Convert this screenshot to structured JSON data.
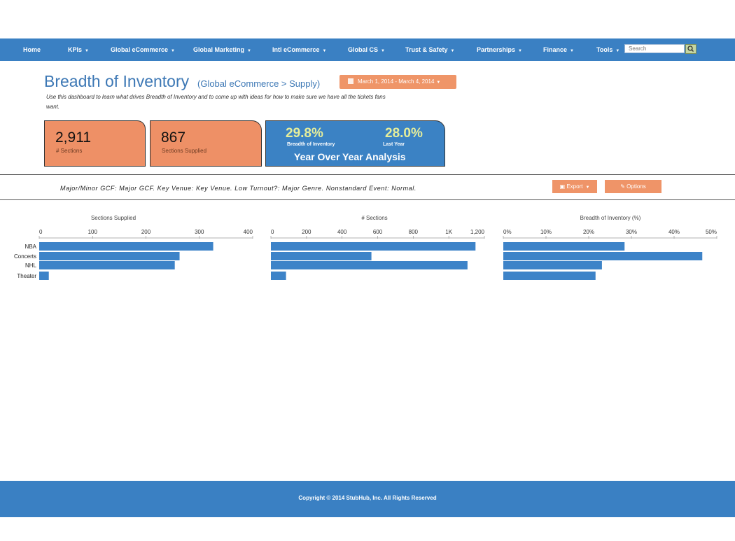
{
  "nav": {
    "items": [
      {
        "label": "Home",
        "caret": false
      },
      {
        "label": "KPIs",
        "caret": true
      },
      {
        "label": "Global eCommerce",
        "caret": true
      },
      {
        "label": "Global Marketing",
        "caret": true
      },
      {
        "label": "Intl eCommerce",
        "caret": true
      },
      {
        "label": "Global CS",
        "caret": true
      },
      {
        "label": "Trust & Safety",
        "caret": true
      },
      {
        "label": "Partnerships",
        "caret": true
      },
      {
        "label": "Finance",
        "caret": true
      },
      {
        "label": "Tools",
        "caret": true
      }
    ],
    "search_placeholder": "Search",
    "search_icon": "search-icon"
  },
  "header": {
    "title": "Breadth of Inventory",
    "breadcrumb": "(Global eCommerce > Supply)",
    "date_range": "March 1, 2014 - March 4, 2014",
    "description": "Use this dashboard to learn what drives Breadth of Inventory and to come up with ideas for how to make sure we have all the tickets fans want."
  },
  "kpis": {
    "sections": {
      "value": "2,911",
      "label": "# Sections"
    },
    "supplied": {
      "value": "867",
      "label": "Sections Supplied"
    },
    "yoy": {
      "current_value": "29.8%",
      "current_label": "Breadth of Inventory",
      "last_value": "28.0%",
      "last_label": "Last Year",
      "title": "Year Over Year Analysis"
    }
  },
  "filters": {
    "text": "Major/Minor GCF: Major GCF. Key Venue: Key Venue. Low Turnout?: Major Genre. Nonstandard Event: Normal.",
    "export_label": "Export",
    "options_label": "Options"
  },
  "colors": {
    "nav": "#3a80c3",
    "accent_orange": "#ee9066",
    "bar": "#3d83c8",
    "yoy_value": "#e6ee9a"
  },
  "chart_data": [
    {
      "type": "bar",
      "orientation": "horizontal",
      "title": "Sections Supplied",
      "categories": [
        "NBA",
        "Concerts",
        "NHL",
        "Theater"
      ],
      "values": [
        326,
        263,
        254,
        18
      ],
      "xlim": [
        0,
        400
      ],
      "ticks": [
        0,
        100,
        200,
        300,
        400
      ],
      "tick_labels": [
        "0",
        "100",
        "200",
        "300",
        "400"
      ]
    },
    {
      "type": "bar",
      "orientation": "horizontal",
      "title": "# Sections",
      "categories": [
        "NBA",
        "Concerts",
        "NHL",
        "Theater"
      ],
      "values": [
        1150,
        565,
        1105,
        85
      ],
      "xlim": [
        0,
        1200
      ],
      "ticks": [
        0,
        200,
        400,
        600,
        800,
        1000,
        1200
      ],
      "tick_labels": [
        "0",
        "200",
        "400",
        "600",
        "800",
        "1K",
        "1,200"
      ]
    },
    {
      "type": "bar",
      "orientation": "horizontal",
      "title": "Breadth of Inventory (%)",
      "categories": [
        "NBA",
        "Concerts",
        "NHL",
        "Theater"
      ],
      "values": [
        28.4,
        46.6,
        23.1,
        21.6
      ],
      "xlim": [
        0,
        50
      ],
      "ticks": [
        0,
        10,
        20,
        30,
        40,
        50
      ],
      "tick_labels": [
        "0%",
        "10%",
        "20%",
        "30%",
        "40%",
        "50%"
      ]
    }
  ],
  "footer": {
    "copyright": "Copyright © 2014 StubHub, Inc. All Rights Reserved"
  }
}
